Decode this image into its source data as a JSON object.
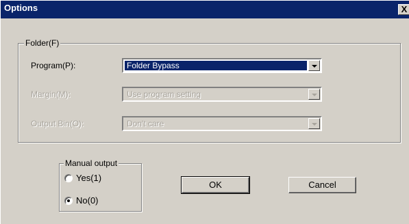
{
  "window": {
    "title": "Options",
    "close_glyph": "X"
  },
  "folder_group": {
    "legend": "Folder(F)",
    "program": {
      "label": "Program(P):",
      "value": "Folder Bypass"
    },
    "margin": {
      "label": "Margin(M):",
      "value": "Use program setting",
      "disabled": true
    },
    "output_bin": {
      "label": "Output Bin(O):",
      "value": "Don't care",
      "disabled": true
    }
  },
  "manual_output": {
    "legend": "Manual output",
    "options": [
      {
        "label": "Yes(1)",
        "checked": false
      },
      {
        "label": "No(0)",
        "checked": true
      }
    ]
  },
  "buttons": {
    "ok": "OK",
    "cancel": "Cancel"
  },
  "colors": {
    "titlebar": "#0a246a",
    "face": "#d4d0c8",
    "selection": "#0a246a"
  }
}
